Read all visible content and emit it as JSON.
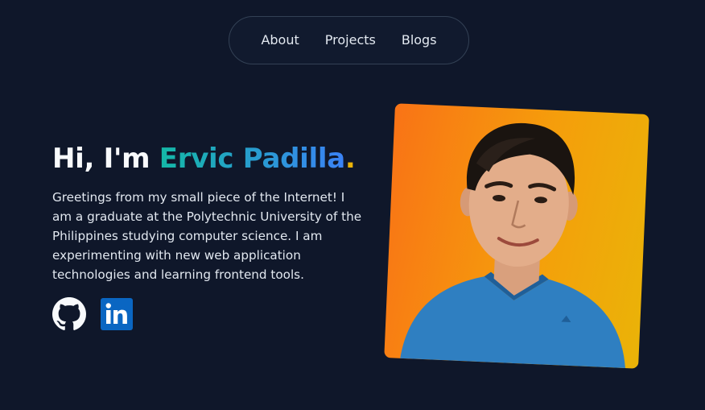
{
  "nav": {
    "items": [
      {
        "label": "About"
      },
      {
        "label": "Projects"
      },
      {
        "label": "Blogs"
      }
    ]
  },
  "hero": {
    "greeting": "Hi, I'm ",
    "name": "Ervic Padilla",
    "punctuation": ".",
    "intro": "Greetings from my small piece of the Internet! I am a graduate at the Polytechnic University of the Philippines studying computer science. I am experimenting with new web application technologies and learning frontend tools."
  },
  "socials": [
    {
      "icon": "github-icon"
    },
    {
      "icon": "linkedin-icon"
    }
  ],
  "colors": {
    "background": "#0f172a",
    "name_gradient_start": "#14b8a6",
    "name_gradient_end": "#3b82f6",
    "portrait_gradient_start": "#f97316",
    "portrait_gradient_end": "#eab308",
    "linkedin": "#0a66c2"
  }
}
